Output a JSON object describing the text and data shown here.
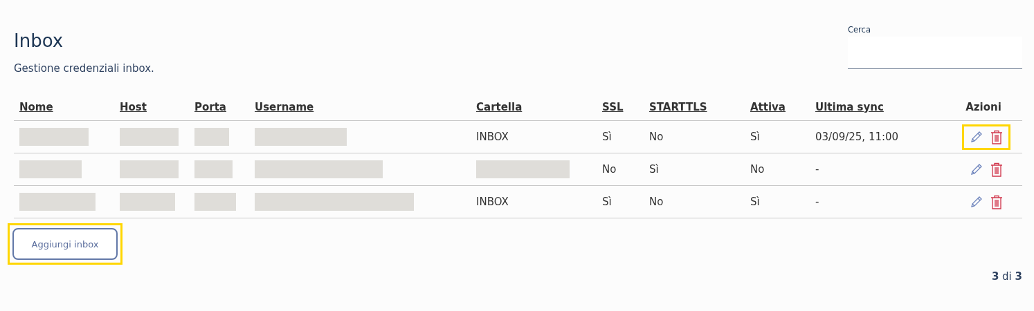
{
  "title": "Inbox",
  "subtitle": "Gestione credenziali inbox.",
  "search": {
    "label": "Cerca"
  },
  "table": {
    "columns": [
      {
        "label": "Nome",
        "sortable": true
      },
      {
        "label": "Host",
        "sortable": true
      },
      {
        "label": "Porta",
        "sortable": true
      },
      {
        "label": "Username",
        "sortable": true
      },
      {
        "label": "Cartella",
        "sortable": true
      },
      {
        "label": "SSL",
        "sortable": true
      },
      {
        "label": "STARTTLS",
        "sortable": true
      },
      {
        "label": "Attiva",
        "sortable": true
      },
      {
        "label": "Ultima sync",
        "sortable": true
      },
      {
        "label": "Azioni",
        "sortable": false
      }
    ],
    "rows": [
      {
        "cells": [
          {
            "redacted": true
          },
          {
            "redacted": true
          },
          {
            "redacted": true
          },
          {
            "redacted": true
          },
          {
            "text": "INBOX"
          },
          {
            "text": "Sì"
          },
          {
            "text": "No"
          },
          {
            "text": "Sì"
          },
          {
            "text": "03/09/25, 11:00"
          }
        ],
        "actions_highlighted": true
      },
      {
        "cells": [
          {
            "redacted": true
          },
          {
            "redacted": true
          },
          {
            "redacted": true
          },
          {
            "redacted": true
          },
          {
            "redacted": true
          },
          {
            "text": "No"
          },
          {
            "text": "Sì"
          },
          {
            "text": "No"
          },
          {
            "text": "-"
          }
        ],
        "actions_highlighted": false
      },
      {
        "cells": [
          {
            "redacted": true
          },
          {
            "redacted": true
          },
          {
            "redacted": true
          },
          {
            "redacted": true
          },
          {
            "text": "INBOX"
          },
          {
            "text": "Sì"
          },
          {
            "text": "No"
          },
          {
            "text": "Sì"
          },
          {
            "text": "-"
          }
        ],
        "actions_highlighted": false
      }
    ]
  },
  "add_button": {
    "label": "Aggiungi inbox",
    "highlighted": true
  },
  "pagination": "**3** di **3**"
}
